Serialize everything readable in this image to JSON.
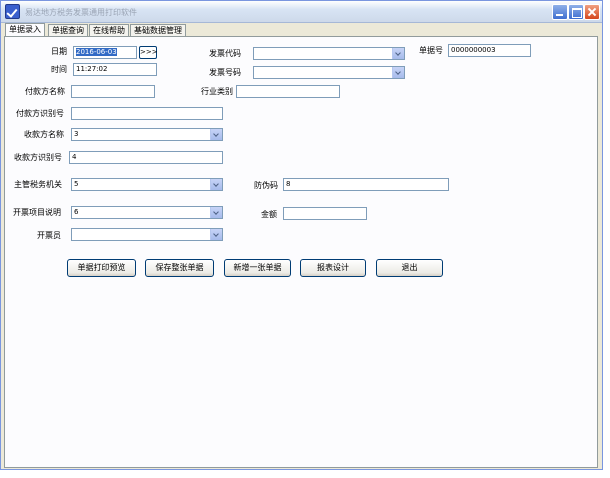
{
  "window": {
    "title": "易达地方税务发票通用打印软件"
  },
  "tabs": [
    {
      "label": "单据录入",
      "active": true
    },
    {
      "label": "单据查询",
      "active": false
    },
    {
      "label": "在线帮助",
      "active": false
    },
    {
      "label": "基础数据管理",
      "active": false
    }
  ],
  "form": {
    "date": {
      "label": "日期",
      "value": "2016-06-03",
      "button": ">>>"
    },
    "time": {
      "label": "时间",
      "value": "11:27:02"
    },
    "invoice_code": {
      "label": "发票代码",
      "value": ""
    },
    "invoice_number": {
      "label": "发票号码",
      "value": ""
    },
    "doc_number": {
      "label": "单据号",
      "value": "0000000003"
    },
    "payer_name": {
      "label": "付款方名称",
      "value": ""
    },
    "industry": {
      "label": "行业类别",
      "value": ""
    },
    "payer_id": {
      "label": "付款方识别号",
      "value": ""
    },
    "payee_name": {
      "label": "收款方名称",
      "value": "3"
    },
    "payee_id": {
      "label": "收款方识别号",
      "value": "4"
    },
    "tax_office": {
      "label": "主管税务机关",
      "value": "5"
    },
    "anti_fake": {
      "label": "防伪码",
      "value": "8"
    },
    "item_desc": {
      "label": "开票项目说明",
      "value": "6"
    },
    "amount": {
      "label": "金额",
      "value": ""
    },
    "issuer": {
      "label": "开票员",
      "value": ""
    }
  },
  "buttons": {
    "print_preview": "单据打印预览",
    "save": "保存整张单据",
    "new": "新增一张单据",
    "report_design": "报表设计",
    "exit": "退出"
  },
  "colors": {
    "titlebar": "#d8e4f4",
    "window_bg": "#ece9d8",
    "input_border": "#7f9db9",
    "selection": "#316ac5"
  }
}
